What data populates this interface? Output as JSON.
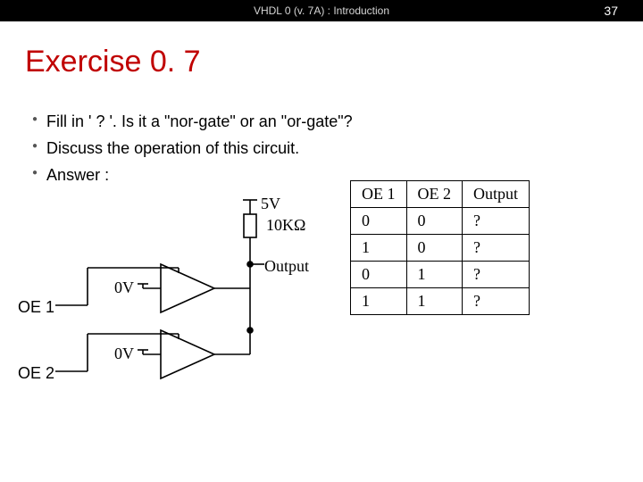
{
  "header": {
    "title": "VHDL 0 (v. 7A) : Introduction",
    "page": "37"
  },
  "slide": {
    "title": "Exercise 0. 7"
  },
  "bullets": [
    "Fill in ' ? '. Is it a \"nor-gate\" or an \"or-gate\"?",
    "Discuss the operation of this circuit.",
    "Answer :"
  ],
  "circuit": {
    "voltage_label": "5V",
    "resistor_label": "10KΩ",
    "output_label": "Output",
    "oe1_label": "OE 1",
    "oe2_label": "OE 2",
    "buf_in_voltage": "0V"
  },
  "truth_table": {
    "headers": [
      "OE 1",
      "OE 2",
      "Output"
    ],
    "rows": [
      [
        "0",
        "0",
        "?"
      ],
      [
        "1",
        "0",
        "?"
      ],
      [
        "0",
        "1",
        "?"
      ],
      [
        "1",
        "1",
        "?"
      ]
    ]
  }
}
